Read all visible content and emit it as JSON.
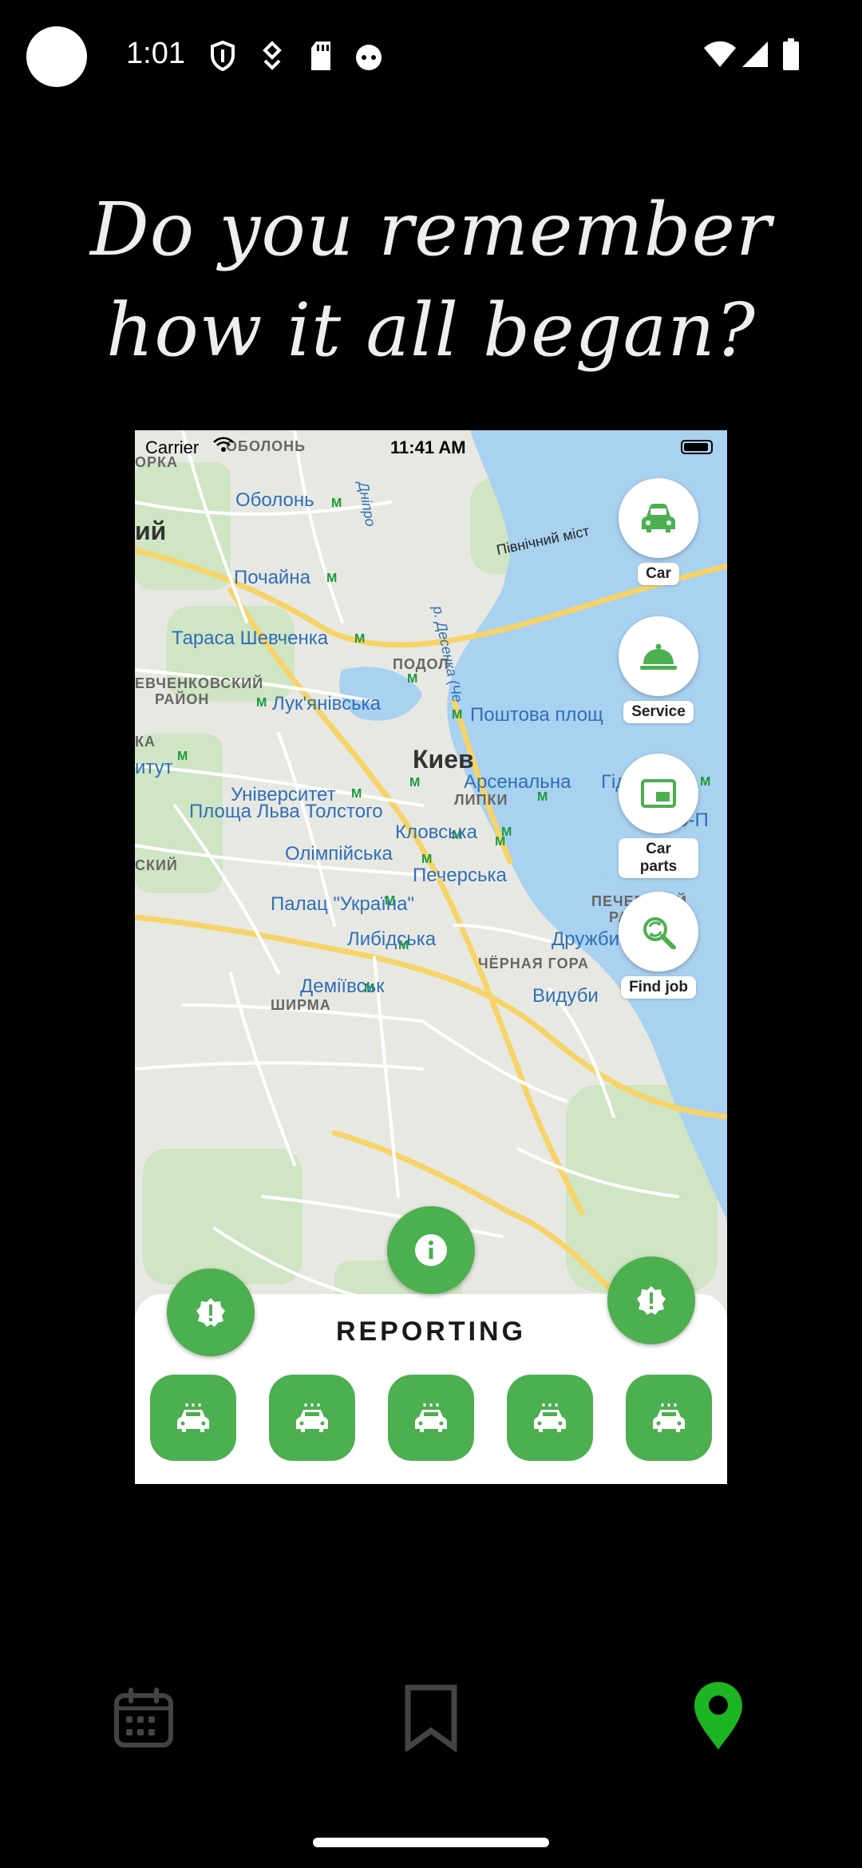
{
  "status_bar": {
    "time": "1:01"
  },
  "heading": {
    "line1": "Do you remember",
    "line2": "how it all began?"
  },
  "screenshot": {
    "ios_status": {
      "carrier": "Carrier",
      "time": "11:41 AM"
    },
    "map_labels": {
      "obolon_district": "ОБОЛОНЬ",
      "orka": "ОРКА",
      "obolon": "Оболонь",
      "dnipro": "Дніпро",
      "pivnichnyi": "Північний міст",
      "pochaina": "Почайна",
      "desenka": "р. Десенка (Че",
      "tarasa": "Тараса Шевченка",
      "podol": "ПОДОЛ",
      "shevchenkivskyi": "ЕВЧЕНКОВСКИЙ",
      "raion": "РАЙОН",
      "lukianivska": "Лук'янівська",
      "poshtova": "Поштова площ",
      "ka": "КА",
      "kyiv": "Киев",
      "instytut": "итут",
      "universytet": "Університет",
      "arsenalna": "Арсенальна",
      "hidro": "Гід",
      "lypky": "ЛИПКИ",
      "lva_tolstoho": "Площа Льва Толстого",
      "kyievo": "Києво-П",
      "klovska": "Кловська",
      "olimpiiska": "Олімпійська",
      "skyi": "СКИЙ",
      "pecherska": "Печерська",
      "palats": "Палац \"Україна\"",
      "pecherskyi": "ПЕЧЕРСКИЙ",
      "raion2": "РАЙОН",
      "lybidska": "Либідська",
      "druzhby": "Дружби народів",
      "chorna_hora": "ЧЁРНАЯ ГОРА",
      "demiivska": "Деміївськ",
      "shyrma": "ШИРМА",
      "vydubychi": "Видуби"
    },
    "categories": [
      {
        "label": "Car",
        "icon": "car-icon"
      },
      {
        "label": "Service",
        "icon": "service-bell-icon"
      },
      {
        "label": "Car parts",
        "icon": "car-parts-icon"
      },
      {
        "label": "Find job",
        "icon": "find-job-icon"
      }
    ],
    "sheet": {
      "title": "REPORTING"
    },
    "accent_color": "#4caf50"
  },
  "nav": {
    "items": [
      {
        "icon": "calendar-icon",
        "active": false
      },
      {
        "icon": "bookmark-icon",
        "active": false
      },
      {
        "icon": "location-pin-icon",
        "active": true
      }
    ],
    "active_color": "#1db521",
    "inactive_color": "#444444"
  }
}
